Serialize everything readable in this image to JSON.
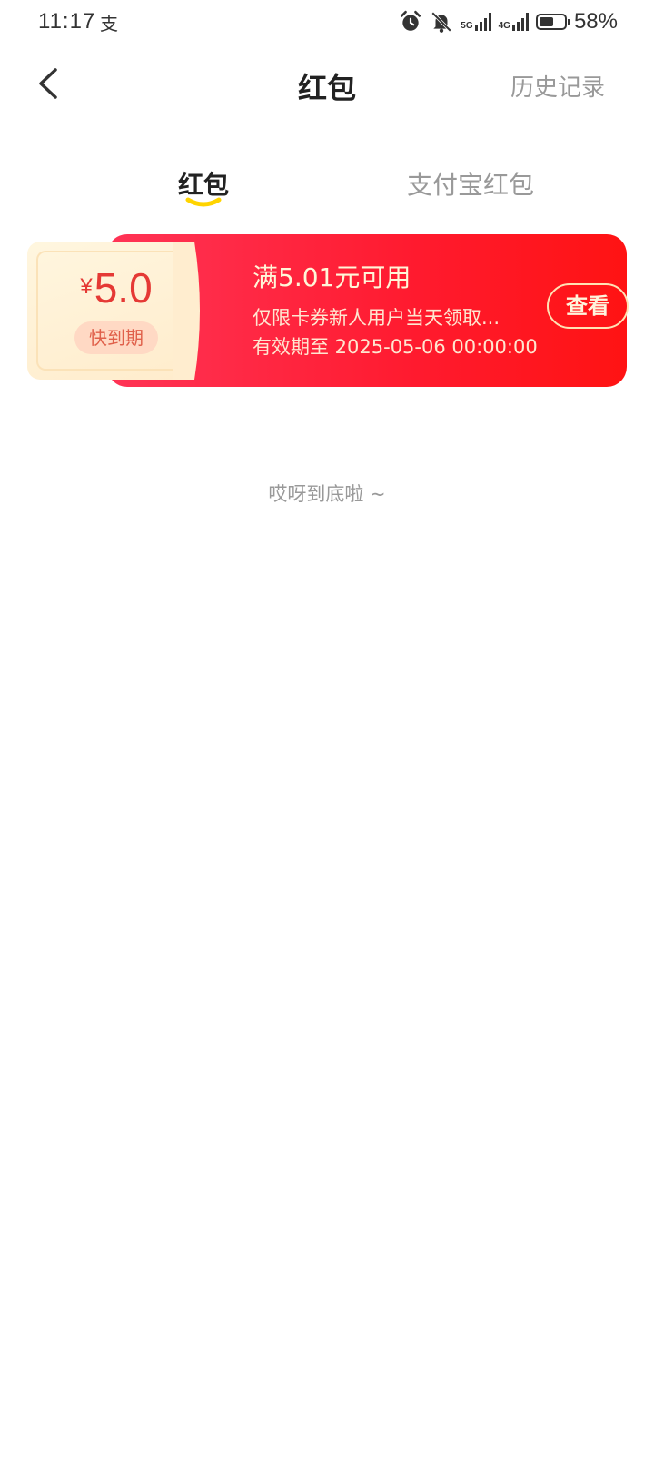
{
  "status_bar": {
    "time": "11:17",
    "alipay_icon_text": "支",
    "net1_label": "5G",
    "net2_label": "4G",
    "battery_percent": 58,
    "battery_text": "58%"
  },
  "header": {
    "title": "红包",
    "history_label": "历史记录"
  },
  "tabs": [
    {
      "label": "红包",
      "active": true
    },
    {
      "label": "支付宝红包",
      "active": false
    }
  ],
  "coupon": {
    "currency_symbol": "¥",
    "amount": "5.0",
    "badge": "快到期",
    "title": "满5.01元可用",
    "description": "仅限卡券新人用户当天领取...",
    "expiry": "有效期至 2025-05-06 00:00:00",
    "action_label": "查看"
  },
  "end_message": "哎呀到底啦 ~",
  "colors": {
    "accent_red": "#ff1a2e",
    "tab_indicator": "#ffd400",
    "muted_text": "#999999"
  }
}
